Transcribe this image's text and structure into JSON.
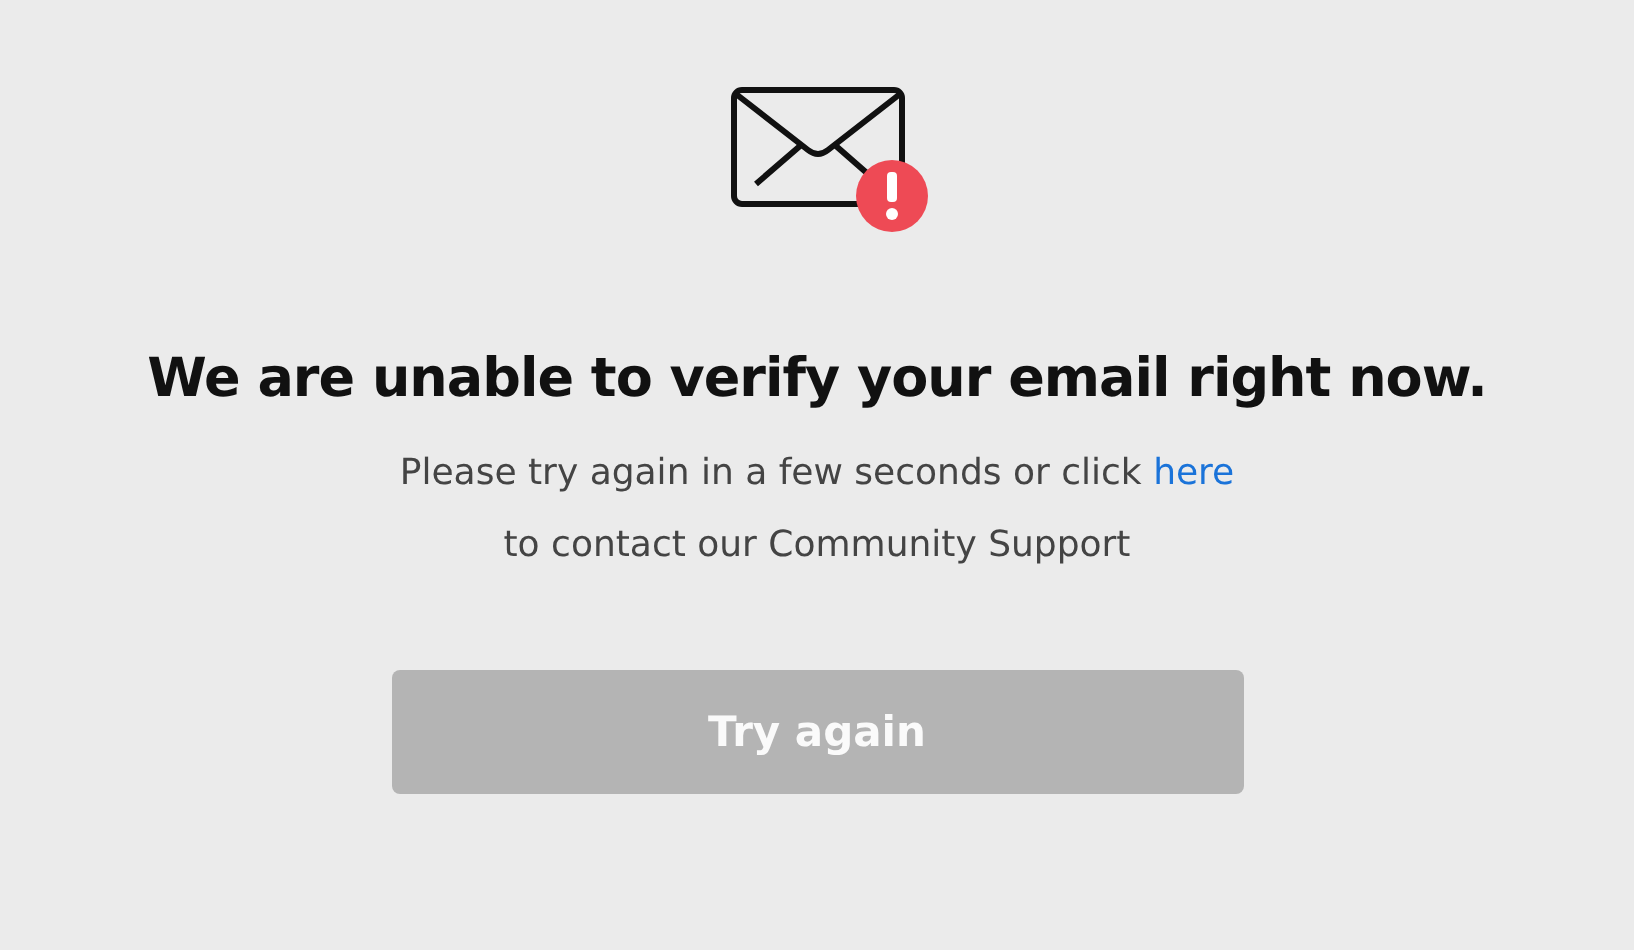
{
  "title": "We are unable to verify your email right now.",
  "message": {
    "before": "Please try again in a few seconds or click",
    "link": "here",
    "after": "to contact our Community Support"
  },
  "button": {
    "label": "Try again",
    "disabled": true
  }
}
